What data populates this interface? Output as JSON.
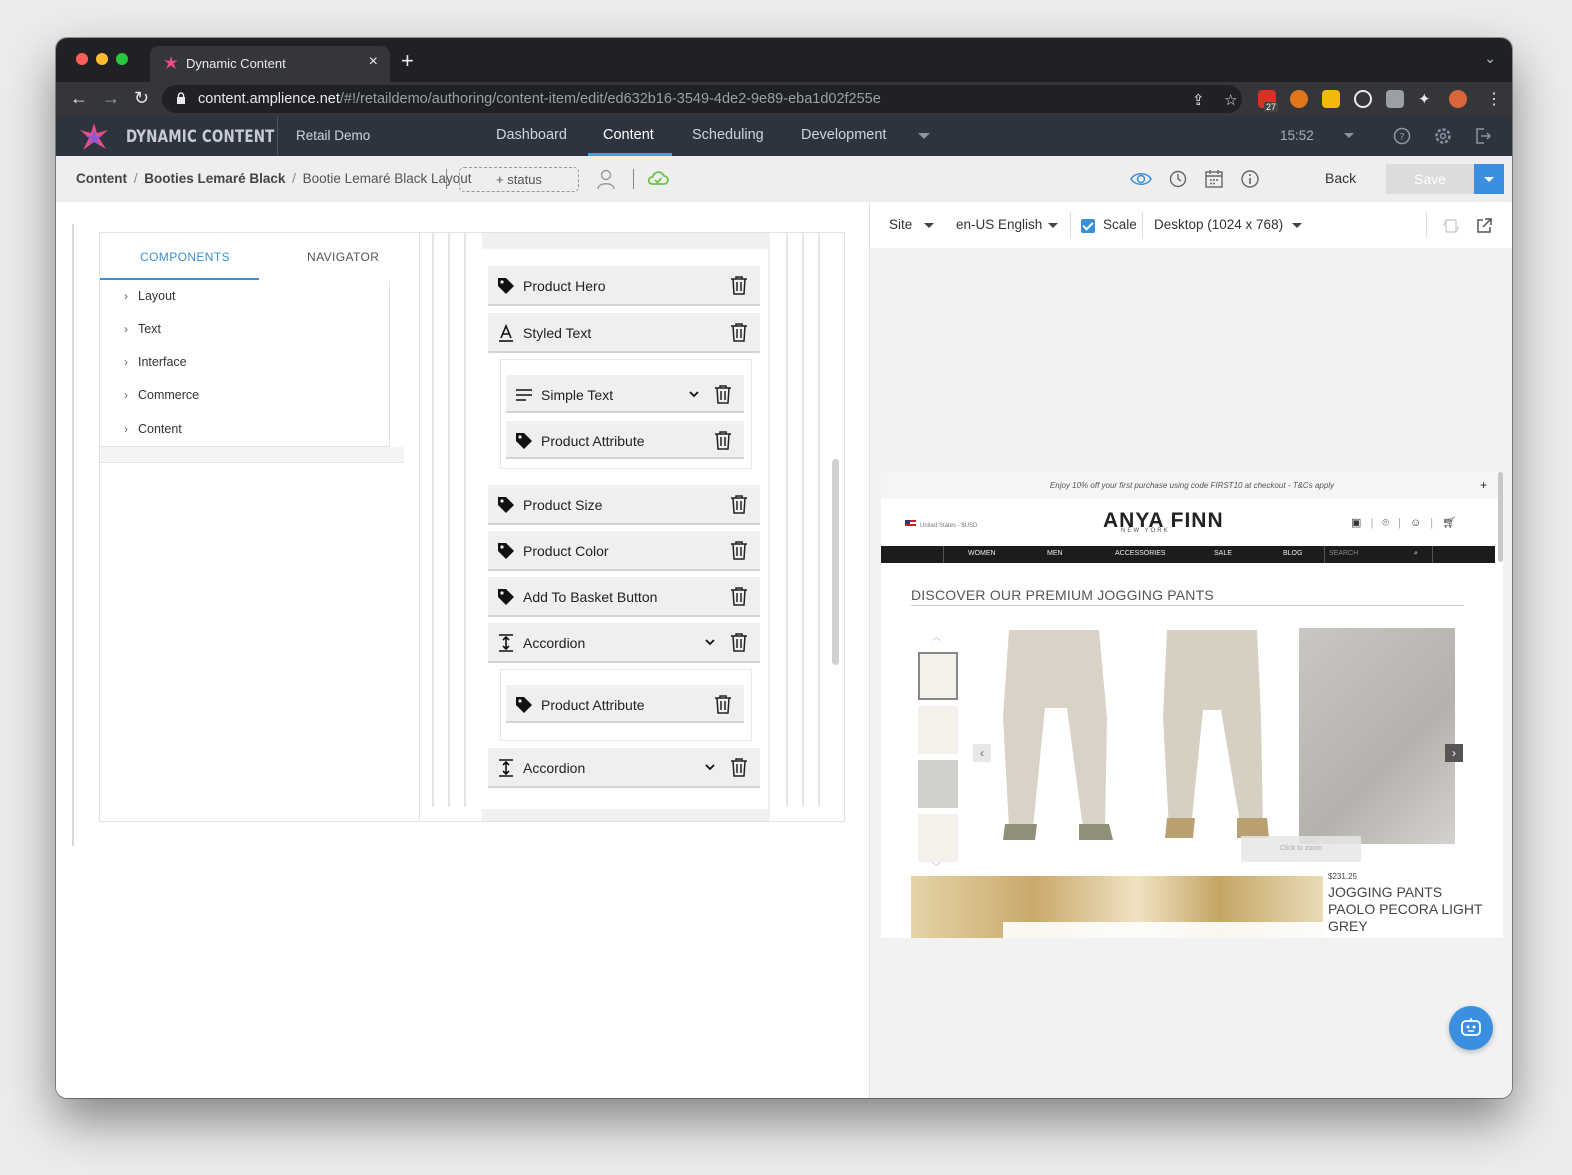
{
  "browser": {
    "tab_title": "Dynamic Content",
    "url_host": "content.amplience.net",
    "url_path": "/#!/retaildemo/authoring/content-item/edit/ed632b16-3549-4de2-9e89-eba1d02f255e",
    "ext_badge": "27"
  },
  "app": {
    "brand": "DYNAMIC CONTENT",
    "hub": "Retail Demo",
    "nav": [
      "Dashboard",
      "Content",
      "Scheduling",
      "Development"
    ],
    "active_nav": "Content",
    "time": "15:52"
  },
  "breadcrumb": {
    "root": "Content",
    "parent": "Booties Lemaré Black",
    "current": "Bootie Lemaré Black Layout",
    "status_button": "+ status",
    "back": "Back",
    "save": "Save"
  },
  "components_panel": {
    "tabs": [
      "COMPONENTS",
      "NAVIGATOR"
    ],
    "items": [
      "Layout",
      "Text",
      "Interface",
      "Commerce",
      "Content"
    ]
  },
  "layout_cards": [
    {
      "label": "Product Hero",
      "icon": "tag-icon"
    },
    {
      "label": "Styled Text",
      "icon": "text-format-icon"
    },
    {
      "label": "Simple Text",
      "icon": "paragraph-icon"
    },
    {
      "label": "Product Attribute",
      "icon": "tag-icon"
    },
    {
      "label": "Product Size",
      "icon": "tag-icon"
    },
    {
      "label": "Product Color",
      "icon": "tag-icon"
    },
    {
      "label": "Add To Basket Button",
      "icon": "tag-icon"
    },
    {
      "label": "Accordion",
      "icon": "accordion-icon"
    },
    {
      "label": "Product Attribute",
      "icon": "tag-icon"
    },
    {
      "label": "Accordion",
      "icon": "accordion-icon"
    }
  ],
  "preview": {
    "site": "Site",
    "locale": "en-US English",
    "scale_label": "Scale",
    "scale_checked": true,
    "device": "Desktop (1024 x 768)"
  },
  "site": {
    "promo": "Enjoy 10% off your first purchase using code FIRST10 at checkout - T&Cs apply",
    "region": "United States - $USD",
    "logo": "ANYA FINN",
    "logo_sub": "NEW YORK",
    "nav": [
      "WOMEN",
      "MEN",
      "ACCESSORIES",
      "SALE",
      "BLOG",
      "SEARCH"
    ],
    "heading": "DISCOVER OUR PREMIUM JOGGING PANTS",
    "zoom_hint": "Click to zoom",
    "price": "$231.25",
    "product_name": "JOGGING PANTS PAOLO PECORA LIGHT GREY"
  },
  "colors": {
    "accent": "#3a8fd8",
    "header_bg": "#2e3340",
    "chrome_bg": "#202124"
  }
}
